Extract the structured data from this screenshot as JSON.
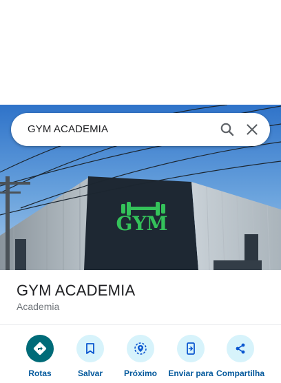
{
  "search": {
    "query": "GYM ACADEMIA"
  },
  "photo": {
    "sign_text": "GYM"
  },
  "place": {
    "title": "GYM ACADEMIA",
    "category": "Academia"
  },
  "actions": [
    {
      "label": "Rotas",
      "icon": "directions-icon"
    },
    {
      "label": "Salvar",
      "icon": "bookmark-icon"
    },
    {
      "label": "Próximo",
      "icon": "nearby-icon"
    },
    {
      "label": "Enviar para",
      "icon": "send-to-phone-icon"
    },
    {
      "label": "Compartilha",
      "icon": "share-icon"
    }
  ],
  "colors": {
    "primary_action": "#006b78",
    "action_bg": "#d7f3fb",
    "action_label": "#01579b",
    "sign_green": "#34c25a"
  }
}
